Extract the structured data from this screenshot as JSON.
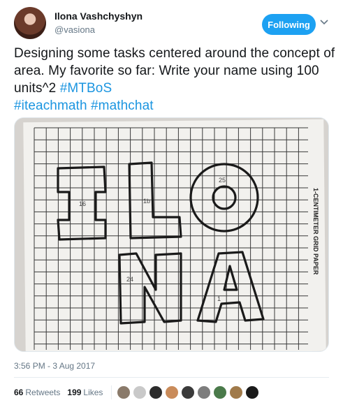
{
  "user": {
    "name": "Ilona Vashchyshyn",
    "handle": "@vasiona",
    "follow_label": "Following"
  },
  "tweet": {
    "text": "Designing some tasks centered around the concept of area. My favorite so far: Write your name using 100 units^2 ",
    "hashtags": [
      "#MTBoS",
      "#iteachmath",
      "#mathchat"
    ],
    "timestamp": "3:56 PM - 3 Aug 2017"
  },
  "media": {
    "paper_label": "1-CENTIMETER GRID PAPER",
    "letters": "ILONA",
    "handwritten_counts": [
      "16",
      "1b",
      "25",
      "24",
      "1"
    ]
  },
  "stats": {
    "retweets_count": "66",
    "retweets_label": "Retweets",
    "likes_count": "199",
    "likes_label": "Likes"
  },
  "likers": [
    {
      "icon": "liker-avatar",
      "color": "#8a7a6a"
    },
    {
      "icon": "liker-avatar",
      "color": "#c9c9c9"
    },
    {
      "icon": "liker-avatar",
      "color": "#2c2c2c"
    },
    {
      "icon": "liker-avatar",
      "color": "#c98b5a"
    },
    {
      "icon": "liker-avatar",
      "color": "#3a3a3a"
    },
    {
      "icon": "liker-avatar",
      "color": "#7d7d7d"
    },
    {
      "icon": "liker-avatar",
      "color": "#4a7a4a"
    },
    {
      "icon": "liker-avatar",
      "color": "#a07a4a"
    },
    {
      "icon": "liker-avatar",
      "color": "#1a1a1a"
    }
  ],
  "colors": {
    "accent": "#1da1f2",
    "hashtag": "#1b95e0",
    "muted": "#657786"
  }
}
